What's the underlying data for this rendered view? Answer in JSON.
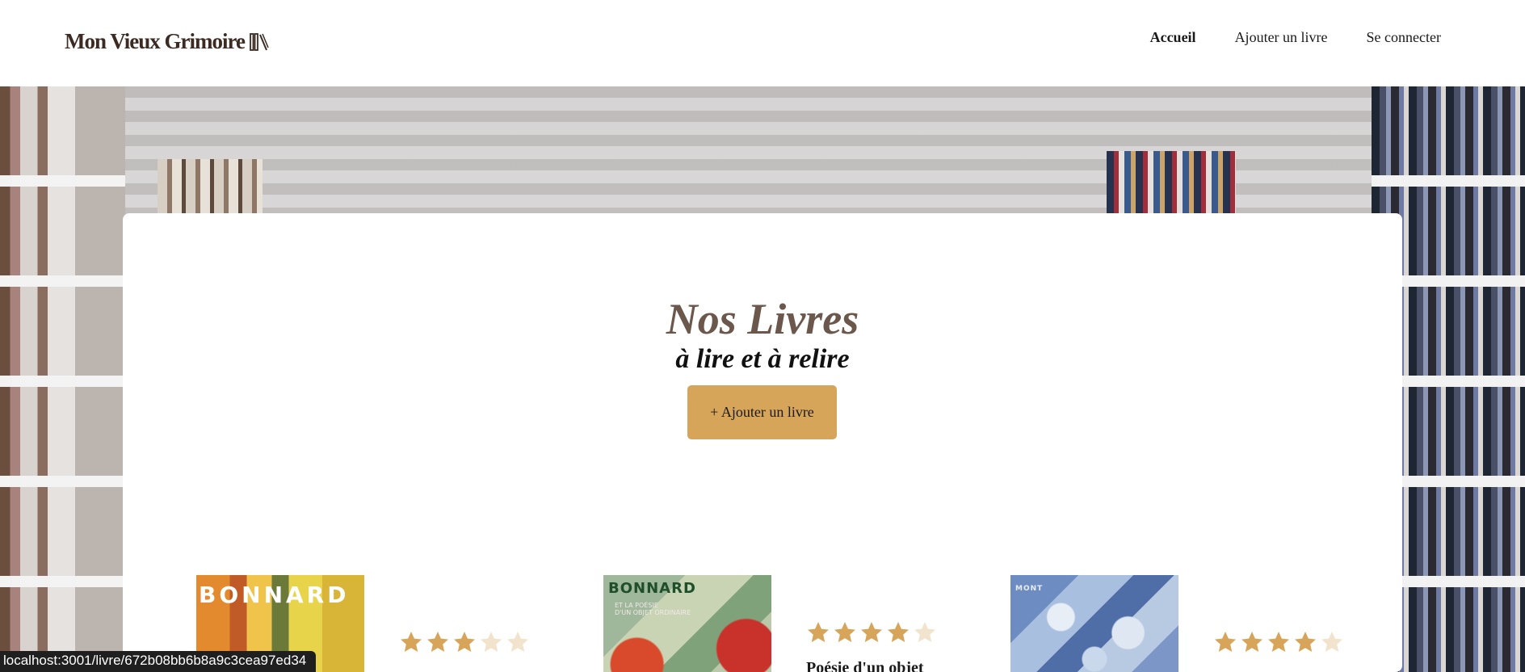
{
  "header": {
    "logo_text": "Mon Vieux Grimoire",
    "logo_icon": "books-icon",
    "nav": [
      {
        "label": "Accueil",
        "active": true
      },
      {
        "label": "Ajouter un livre",
        "active": false
      },
      {
        "label": "Se connecter",
        "active": false
      }
    ]
  },
  "main": {
    "title": "Nos Livres",
    "subtitle": "à lire et à relire",
    "add_button": "+ Ajouter un livre"
  },
  "books": [
    {
      "cover_text": "BONNARD",
      "cover_subtitle": "",
      "rating": 3,
      "title": ""
    },
    {
      "cover_text": "BONNARD",
      "cover_subtitle": "ET LA POÉSIE\nD'UN OBJET ORDINAIRE",
      "rating": 4,
      "title": "Poésie d'un objet"
    },
    {
      "cover_text": "MONT",
      "cover_subtitle": "",
      "rating": 4,
      "title": ""
    }
  ],
  "status_bar": {
    "url": "localhost:3001/livre/672b08bb6b8a9c3cea97ed34"
  },
  "colors": {
    "accent": "#d6a55a",
    "star_filled": "#d6a55a",
    "star_empty": "#f1e3cc",
    "title_color": "#6b574c"
  }
}
